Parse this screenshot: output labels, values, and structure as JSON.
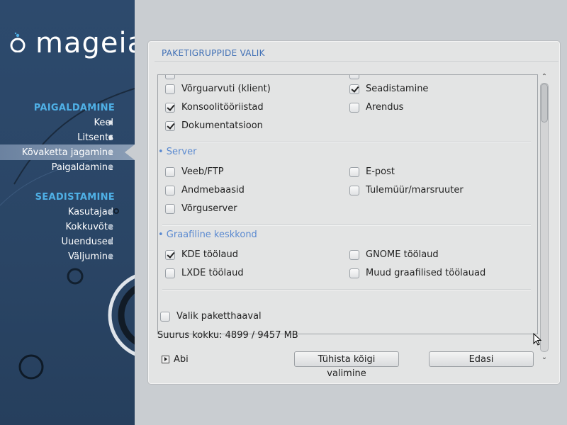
{
  "brand": {
    "name": "mageia",
    "accent": "#4fb0e6"
  },
  "sidebar": {
    "sections": [
      {
        "title": "PAIGALDAMINE",
        "items": [
          "Keel",
          "Litsents",
          "Kõvaketta jagamine",
          "Paigaldamine"
        ]
      },
      {
        "title": "SEADISTAMINE",
        "items": [
          "Kasutajad",
          "Kokkuvõte",
          "Uuendused",
          "Väljumine"
        ]
      }
    ],
    "active_item": "Kõvaketta jagamine"
  },
  "panel": {
    "title": "PAKETIGRUPPIDE VALIK",
    "options_top": [
      {
        "label": "Võrguarvuti (klient)",
        "checked": false
      },
      {
        "label": "Seadistamine",
        "checked": true
      },
      {
        "label": "Konsoolitööriistad",
        "checked": true
      },
      {
        "label": "Arendus",
        "checked": false
      },
      {
        "label": "Dokumentatsioon",
        "checked": true
      }
    ],
    "groups": [
      {
        "title": "• Server",
        "options": [
          {
            "label": "Veeb/FTP",
            "checked": false
          },
          {
            "label": "E-post",
            "checked": false
          },
          {
            "label": "Andmebaasid",
            "checked": false
          },
          {
            "label": "Tulemüür/marsruuter",
            "checked": false
          },
          {
            "label": "Võrguserver",
            "checked": false
          }
        ]
      },
      {
        "title": "• Graafiline keskkond",
        "options": [
          {
            "label": "KDE töölaud",
            "checked": true
          },
          {
            "label": "GNOME töölaud",
            "checked": false
          },
          {
            "label": "LXDE töölaud",
            "checked": false
          },
          {
            "label": "Muud graafilised töölauad",
            "checked": false
          }
        ]
      }
    ],
    "individual_select": {
      "label": "Valik paketthaaval",
      "checked": false
    },
    "size_total": "Suurus kokku: 4899 / 9457 MB",
    "help_label": "Abi",
    "deselect_all_label": "Tühista kõigi valimine",
    "next_label": "Edasi"
  }
}
